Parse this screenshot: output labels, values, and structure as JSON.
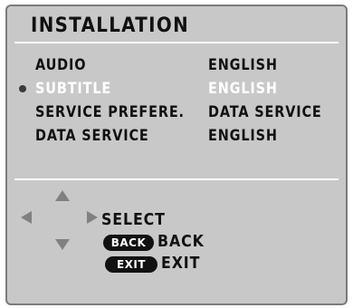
{
  "menu": {
    "title": "INSTALLATION",
    "items": [
      {
        "label": "AUDIO",
        "value": "ENGLISH",
        "selected": false
      },
      {
        "label": "SUBTITLE",
        "value": "ENGLISH",
        "selected": true
      },
      {
        "label": "SERVICE PREFERE.",
        "value": "DATA SERVICE",
        "selected": false
      },
      {
        "label": "DATA SERVICE",
        "value": "ENGLISH",
        "selected": false
      }
    ]
  },
  "help": {
    "select_label": "SELECT",
    "back_key": "BACK",
    "back_label": "BACK",
    "exit_key": "EXIT",
    "exit_label": "EXIT"
  },
  "icons": {
    "nav": [
      "arrow-up-icon",
      "arrow-down-icon",
      "arrow-left-icon",
      "arrow-right-icon"
    ],
    "selection": "bullet-icon"
  },
  "colors": {
    "panel_background": "#c8c8c8",
    "panel_border": "#7b7b7b",
    "text": "#111111",
    "selected_text": "#ffffff",
    "arrow": "#808080",
    "key_background": "#111111"
  }
}
